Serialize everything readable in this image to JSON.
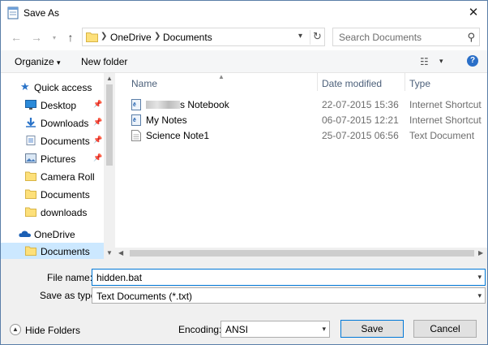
{
  "window": {
    "title": "Save As"
  },
  "nav": {
    "breadcrumb": [
      "OneDrive",
      "Documents"
    ],
    "search_placeholder": "Search Documents"
  },
  "toolbar": {
    "organize": "Organize",
    "new_folder": "New folder"
  },
  "sidebar": {
    "items": [
      {
        "label": "Quick access",
        "icon": "star-icon"
      },
      {
        "label": "Desktop",
        "icon": "desktop-icon",
        "pinned": true
      },
      {
        "label": "Downloads",
        "icon": "download-icon",
        "pinned": true
      },
      {
        "label": "Documents",
        "icon": "documents-icon",
        "pinned": true
      },
      {
        "label": "Pictures",
        "icon": "pictures-icon",
        "pinned": true
      },
      {
        "label": "Camera Roll",
        "icon": "folder-icon"
      },
      {
        "label": "Documents",
        "icon": "folder-icon"
      },
      {
        "label": "downloads",
        "icon": "folder-icon"
      },
      {
        "label": "OneDrive",
        "icon": "cloud-icon"
      },
      {
        "label": "Documents",
        "icon": "folder-icon",
        "selected": true
      }
    ]
  },
  "columns": {
    "name": "Name",
    "date": "Date modified",
    "type": "Type"
  },
  "files": [
    {
      "name_suffix": "s Notebook",
      "date": "22-07-2015 15:36",
      "type": "Internet Shortcut"
    },
    {
      "name": "My Notes",
      "date": "06-07-2015 12:21",
      "type": "Internet Shortcut"
    },
    {
      "name": "Science Note1",
      "date": "25-07-2015 06:56",
      "type": "Text Document"
    }
  ],
  "form": {
    "filename_label": "File name:",
    "filename_value": "hidden.bat",
    "savetype_label": "Save as type:",
    "savetype_value": "Text Documents (*.txt)",
    "encoding_label": "Encoding:",
    "encoding_value": "ANSI",
    "hide_folders": "Hide Folders",
    "save": "Save",
    "cancel": "Cancel"
  }
}
